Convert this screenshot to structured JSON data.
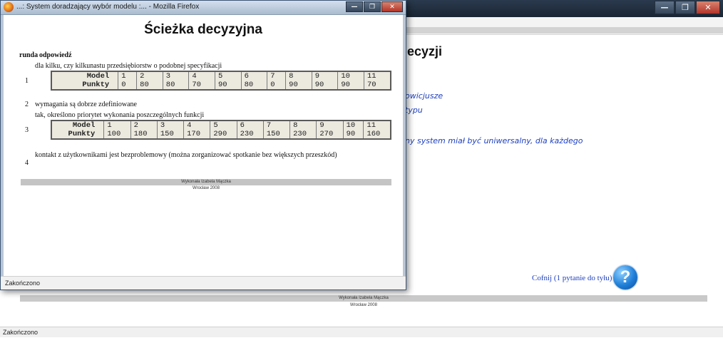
{
  "background_window": {
    "heading": "decyzji",
    "italic_texts": [
      "owicjusze",
      "typu",
      "ny system miał być uniwersalny, dla każdego"
    ],
    "back_link": "Cofnij (1 pytanie do tyłu)",
    "help_icon": "question-mark-icon",
    "footer_author": "Wykonała Izabela Mączka",
    "footer_city": "Wrocław 2008",
    "status": "Zakończono",
    "controls": [
      "—",
      "❐",
      "✕"
    ]
  },
  "popup": {
    "window_title": "...: System doradzający wybór modelu :...  - Mozilla Firefox",
    "controls": [
      "—",
      "❐",
      "✕"
    ],
    "heading": "Ścieżka decyzyjna",
    "col_runda": "runda",
    "col_odpowiedz": "odpowiedź",
    "rounds": [
      {
        "runda": "1",
        "answer": "dla kilku, czy kilkunastu przedsiębiorstw o podobnej specyfikacji",
        "table": {
          "model_label": "Model",
          "points_label": "Punkty",
          "models": [
            "1",
            "2",
            "3",
            "4",
            "5",
            "6",
            "7",
            "8",
            "9",
            "10",
            "11"
          ],
          "points": [
            "0",
            "80",
            "80",
            "70",
            "90",
            "80",
            "0",
            "90",
            "90",
            "90",
            "70"
          ]
        }
      },
      {
        "runda": "2",
        "answer": "wymagania są dobrze zdefiniowane"
      },
      {
        "runda": "3",
        "answer": "tak, określono priorytet wykonania poszczególnych funkcji",
        "table": {
          "model_label": "Model",
          "points_label": "Punkty",
          "models": [
            "1",
            "2",
            "3",
            "4",
            "5",
            "6",
            "7",
            "8",
            "9",
            "10",
            "11"
          ],
          "points": [
            "100",
            "180",
            "150",
            "170",
            "290",
            "230",
            "150",
            "230",
            "270",
            "90",
            "160"
          ]
        }
      },
      {
        "runda": "4",
        "answer": "kontakt z użytkownikami jest bezproblemowy (można zorganizować spotkanie bez większych przeszkód)"
      }
    ],
    "footer_author": "Wykonała Izabela Mączka",
    "footer_city": "Wrocław 2008",
    "status": "Zakończono"
  }
}
